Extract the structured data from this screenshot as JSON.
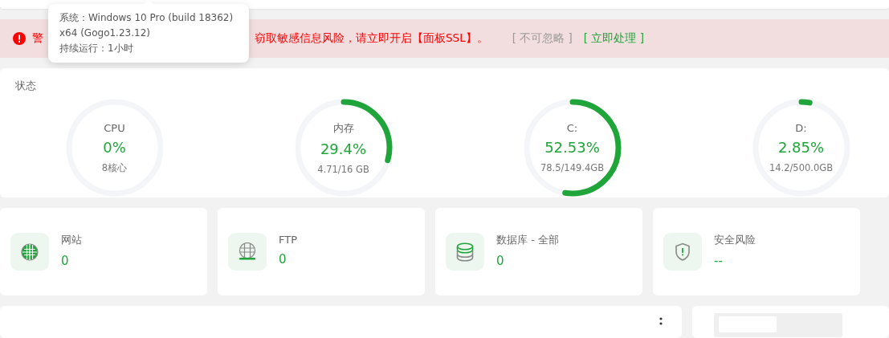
{
  "alert": {
    "prefix": "警",
    "message": "窃取敏感信息风险，请立即开启【面板SSL】。",
    "ignore": "[ 不可忽略 ]",
    "action": "[ 立即处理 ]"
  },
  "tooltip": {
    "lines": [
      "系统：Windows 10 Pro (build 18362)",
      "x64 (Gogo1.23.12)",
      "持续运行：1小时"
    ]
  },
  "status": {
    "title": "状态",
    "gauges": [
      {
        "label": "CPU",
        "value": "0%",
        "detail": "8核心"
      },
      {
        "label": "内存",
        "value": "29.4%",
        "detail": "4.71/16 GB",
        "level": 0.294
      },
      {
        "label": "C:",
        "value": "52.53%",
        "detail": "78.5/149.4GB",
        "level": 0.5253
      },
      {
        "label": "D:",
        "value": "2.85%",
        "detail": "14.2/500.0GB",
        "level": 0.0285
      }
    ]
  },
  "stats": [
    {
      "kind": "globe",
      "label": "网站",
      "value": "0"
    },
    {
      "kind": "ftp",
      "label": "FTP",
      "value": "0"
    },
    {
      "kind": "database",
      "label": "数据库 - 全部",
      "value": "0"
    },
    {
      "kind": "shield",
      "label": "安全风险",
      "value": "--"
    }
  ]
}
